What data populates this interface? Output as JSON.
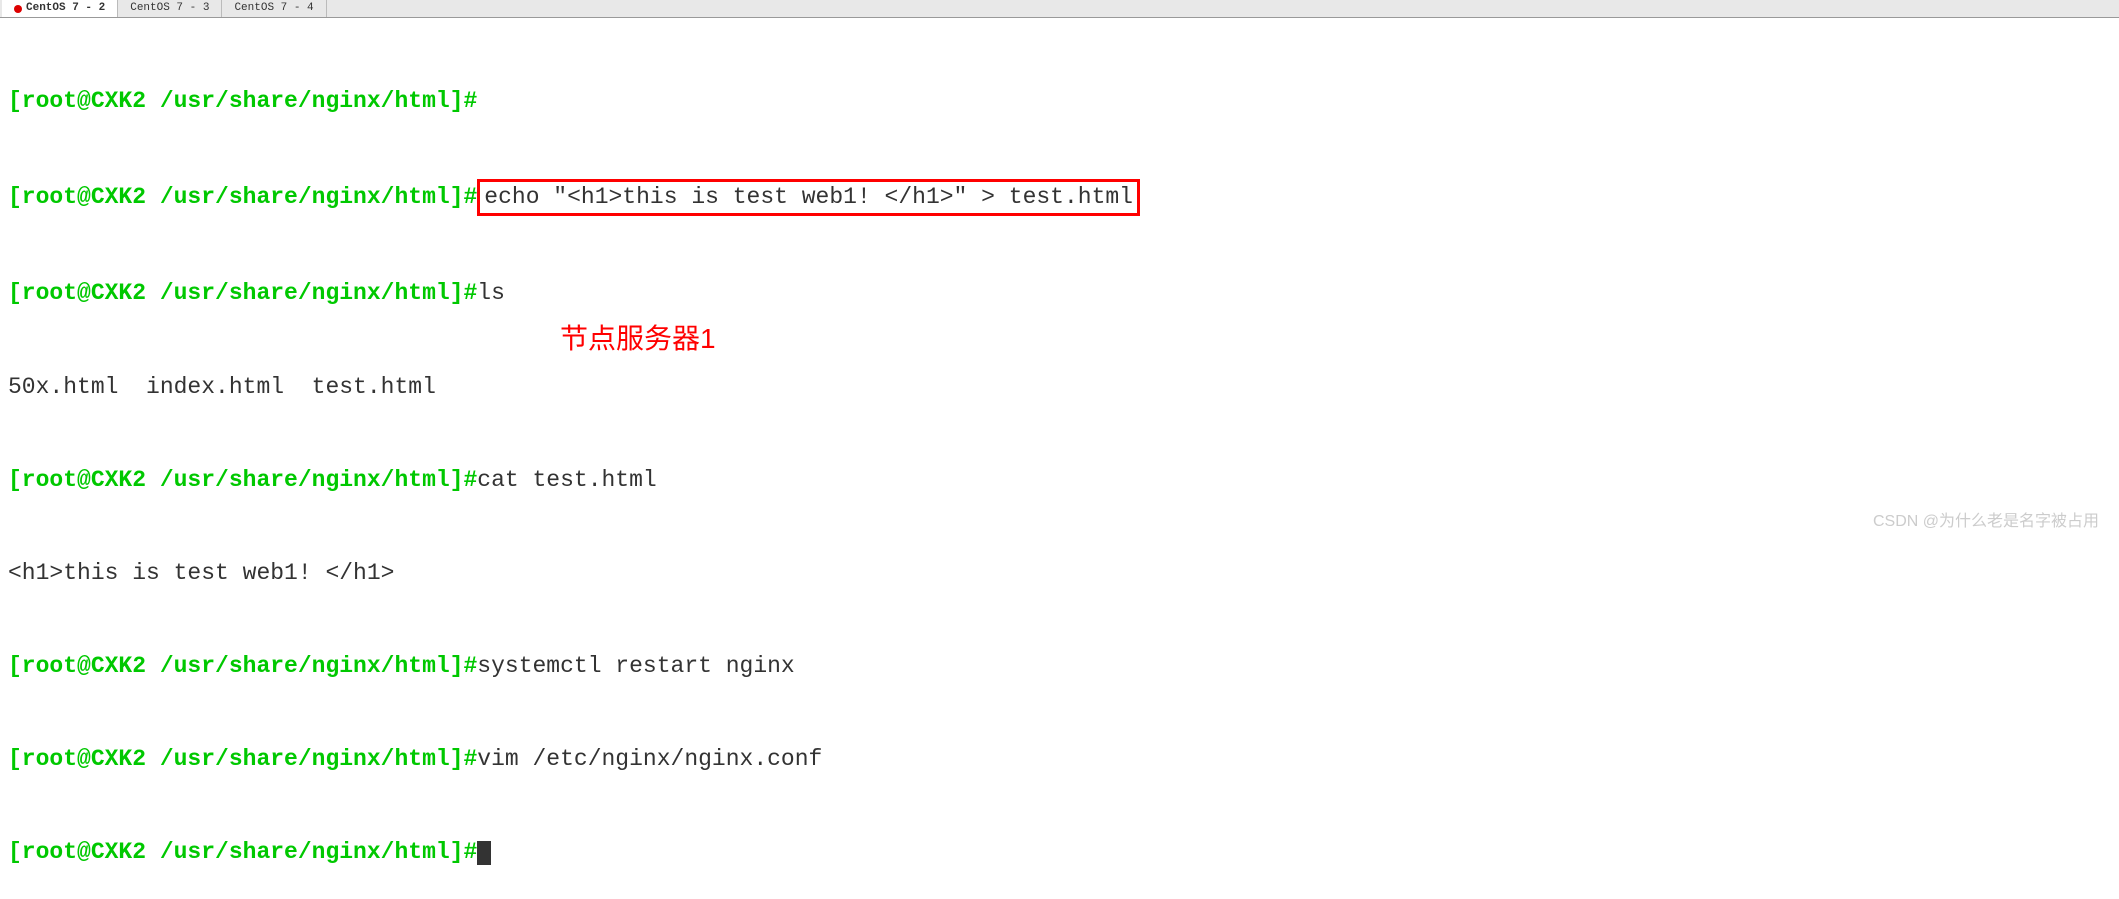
{
  "tabs": [
    {
      "label": "CentOS 7 - 2",
      "active": true
    },
    {
      "label": "CentOS 7 - 3",
      "active": false
    },
    {
      "label": "CentOS 7 - 4",
      "active": false
    }
  ],
  "prompt_text": "[root@CXK2 /usr/share/nginx/html]#",
  "lines": {
    "l0_cmd": "",
    "l1_cmd": "echo \"<h1>this is test web1! </h1>\" > test.html",
    "l2_cmd": "ls",
    "l3_out": "50x.html  index.html  test.html",
    "l4_cmd": "cat test.html",
    "l5_out": "<h1>this is test web1! </h1>",
    "l6_cmd": "systemctl restart nginx",
    "l7_cmd": "vim /etc/nginx/nginx.conf",
    "l8_cmd": ""
  },
  "annotation": "节点服务器1",
  "watermark": "CSDN @为什么老是名字被占用",
  "colors": {
    "prompt": "#00c800",
    "text": "#333333",
    "highlight": "#ff0000"
  }
}
